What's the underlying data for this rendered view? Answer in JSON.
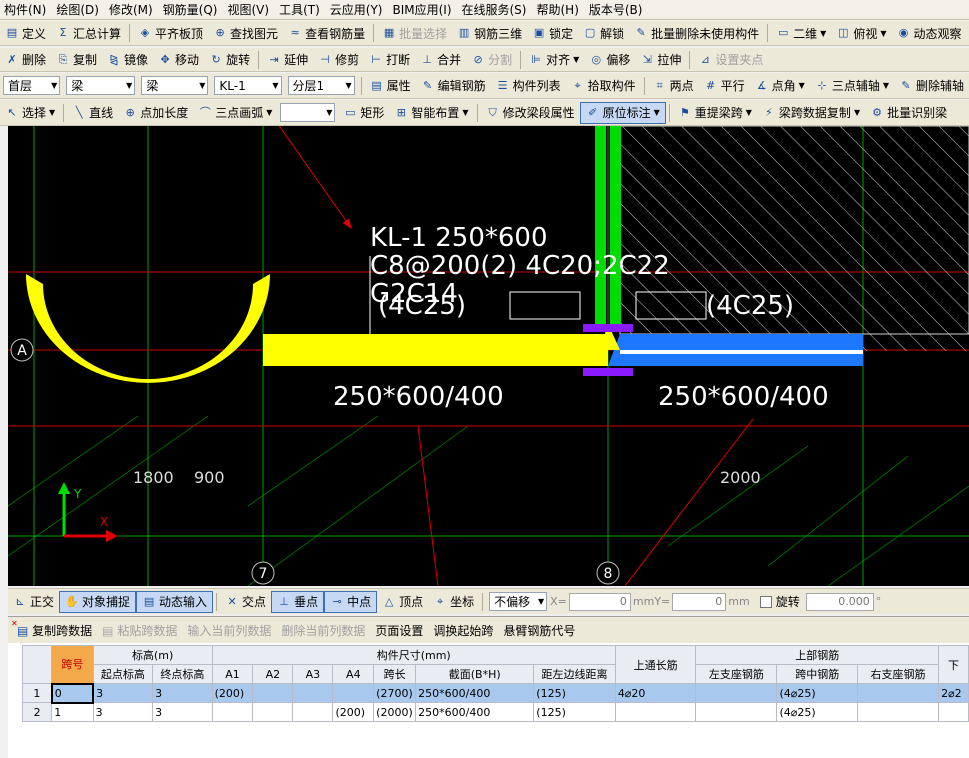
{
  "menu": [
    "构件(N)",
    "绘图(D)",
    "修改(M)",
    "钢筋量(Q)",
    "视图(V)",
    "工具(T)",
    "云应用(Y)",
    "BIM应用(I)",
    "在线服务(S)",
    "帮助(H)",
    "版本号(B)"
  ],
  "toolbar1": [
    {
      "icon": "definition-icon",
      "glyph": "▤",
      "label": "定义"
    },
    {
      "icon": "sigma-icon",
      "glyph": "Σ",
      "label": "汇总计算"
    },
    {
      "icon": "align-slab-icon",
      "glyph": "◈",
      "label": "平齐板顶"
    },
    {
      "icon": "binoculars-icon",
      "glyph": "⊕",
      "label": "查找图元"
    },
    {
      "icon": "rebar-qty-icon",
      "glyph": "≈",
      "label": "查看钢筋量"
    },
    {
      "icon": "batch-select-icon",
      "glyph": "▦",
      "label": "批量选择",
      "disabled": true
    },
    {
      "icon": "rebar-3d-icon",
      "glyph": "▥",
      "label": "钢筋三维"
    },
    {
      "icon": "lock-icon",
      "glyph": "▣",
      "label": "锁定"
    },
    {
      "icon": "unlock-icon",
      "glyph": "▢",
      "label": "解锁"
    },
    {
      "icon": "batch-delete-icon",
      "glyph": "✎",
      "label": "批量删除未使用构件"
    },
    {
      "icon": "view-2d-icon",
      "glyph": "▭",
      "label": "二维",
      "dropdown": true
    },
    {
      "icon": "top-view-icon",
      "glyph": "◫",
      "label": "俯视",
      "dropdown": true
    },
    {
      "icon": "orbit-icon",
      "glyph": "◉",
      "label": "动态观察"
    }
  ],
  "toolbar2": [
    {
      "icon": "delete-icon",
      "glyph": "✗",
      "label": "删除"
    },
    {
      "icon": "copy-icon",
      "glyph": "⎘",
      "label": "复制"
    },
    {
      "icon": "mirror-icon",
      "glyph": "⧎",
      "label": "镜像"
    },
    {
      "icon": "move-icon",
      "glyph": "✥",
      "label": "移动"
    },
    {
      "icon": "rotate-icon",
      "glyph": "↻",
      "label": "旋转"
    },
    {
      "icon": "extend-icon",
      "glyph": "⇥",
      "label": "延伸"
    },
    {
      "icon": "trim-icon",
      "glyph": "⊣",
      "label": "修剪"
    },
    {
      "icon": "break-icon",
      "glyph": "⊢",
      "label": "打断"
    },
    {
      "icon": "merge-icon",
      "glyph": "⊥",
      "label": "合并"
    },
    {
      "icon": "split-icon",
      "glyph": "⊘",
      "label": "分割",
      "disabled": true
    },
    {
      "icon": "align-icon",
      "glyph": "⊫",
      "label": "对齐",
      "dropdown": true
    },
    {
      "icon": "offset-icon",
      "glyph": "◎",
      "label": "偏移"
    },
    {
      "icon": "stretch-icon",
      "glyph": "⇲",
      "label": "拉伸"
    },
    {
      "icon": "set-pinch-icon",
      "glyph": "⊿",
      "label": "设置夹点",
      "disabled": true
    }
  ],
  "toolbar3": {
    "combos": [
      {
        "name": "floor-select",
        "value": "首层",
        "width": 58
      },
      {
        "name": "category-select",
        "value": "梁",
        "width": 70
      },
      {
        "name": "type-select",
        "value": "梁",
        "width": 68
      },
      {
        "name": "member-select",
        "value": "KL-1",
        "width": 68
      },
      {
        "name": "layer-select",
        "value": "分层1",
        "width": 68
      }
    ],
    "buttons": [
      {
        "icon": "property-icon",
        "glyph": "▤",
        "label": "属性"
      },
      {
        "icon": "edit-rebar-icon",
        "glyph": "✎",
        "label": "编辑钢筋"
      },
      {
        "icon": "member-list-icon",
        "glyph": "☰",
        "label": "构件列表"
      },
      {
        "icon": "pick-member-icon",
        "glyph": "⌖",
        "label": "拾取构件"
      },
      {
        "icon": "two-point-icon",
        "glyph": "⌗",
        "label": "两点"
      },
      {
        "icon": "parallel-icon",
        "glyph": "#",
        "label": "平行"
      },
      {
        "icon": "point-angle-icon",
        "glyph": "∡",
        "label": "点角",
        "dropdown": true
      },
      {
        "icon": "three-point-aux-icon",
        "glyph": "⊹",
        "label": "三点辅轴",
        "dropdown": true
      },
      {
        "icon": "delete-aux-icon",
        "glyph": "✎",
        "label": "删除辅轴"
      }
    ]
  },
  "toolbar4": [
    {
      "icon": "select-icon",
      "glyph": "↖",
      "label": "选择",
      "dropdown": true
    },
    {
      "icon": "line-icon",
      "glyph": "╲",
      "label": "直线"
    },
    {
      "icon": "point-length-icon",
      "glyph": "⊕",
      "label": "点加长度"
    },
    {
      "icon": "arc-icon",
      "glyph": "⌒",
      "label": "三点画弧",
      "dropdown": true
    },
    {
      "combo": true,
      "value": "",
      "width": 55
    },
    {
      "icon": "rectangle-icon",
      "glyph": "▭",
      "label": "矩形"
    },
    {
      "icon": "smart-layout-icon",
      "glyph": "⊞",
      "label": "智能布置",
      "dropdown": true
    },
    {
      "icon": "modify-span-icon",
      "glyph": "⛉",
      "label": "修改梁段属性"
    },
    {
      "icon": "origin-annotate-icon",
      "glyph": "✐",
      "label": "原位标注",
      "pressed": true,
      "dropdown": true
    },
    {
      "icon": "reextract-span-icon",
      "glyph": "⚑",
      "label": "重提梁跨",
      "dropdown": true
    },
    {
      "icon": "span-copy-icon",
      "glyph": "⚡",
      "label": "梁跨数据复制",
      "dropdown": true
    },
    {
      "icon": "batch-recognize-icon",
      "glyph": "⚙",
      "label": "批量识别梁"
    }
  ],
  "canvas": {
    "beam_label_lines": [
      "KL-1 250*600",
      "C8@200(2) 4C20;2C22",
      "G2C14"
    ],
    "left_support_label": "(4C25)",
    "right_support_label": "(4C25)",
    "span1_section": "250*600/400",
    "span2_section": "250*600/400",
    "dim_1800": "1800",
    "dim_900": "900",
    "dim_2000": "2000",
    "axis_a": "A",
    "axis_7": "7",
    "axis_8": "8",
    "ucs_y": "Y",
    "ucs_x": "X"
  },
  "statusbar": {
    "buttons": [
      {
        "icon": "ortho-icon",
        "glyph": "⊾",
        "label": "正交"
      },
      {
        "icon": "object-snap-icon",
        "glyph": "✋",
        "label": "对象捕捉",
        "pressed": true
      },
      {
        "icon": "dynamic-input-icon",
        "glyph": "▤",
        "label": "动态输入",
        "pressed": true
      },
      {
        "icon": "intersection-icon",
        "glyph": "✕",
        "label": "交点"
      },
      {
        "icon": "perpendicular-icon",
        "glyph": "⊥",
        "label": "垂点",
        "pressed": true
      },
      {
        "icon": "midpoint-icon",
        "glyph": "⊸",
        "label": "中点",
        "pressed": true
      },
      {
        "icon": "vertex-icon",
        "glyph": "△",
        "label": "顶点"
      },
      {
        "icon": "coordinate-icon",
        "glyph": "⌖",
        "label": "坐标"
      }
    ],
    "offset_combo": "不偏移",
    "x_label": "X=",
    "x_value": "0",
    "mm1": "mm",
    "y_label": "Y=",
    "y_value": "0",
    "mm2": "mm",
    "rotate_label": "旋转",
    "rotate_value": "0.000",
    "degree": "°"
  },
  "panel": {
    "tools": [
      {
        "icon": "copy-span-icon",
        "label": "复制跨数据"
      },
      {
        "icon": "paste-span-icon",
        "label": "粘贴跨数据",
        "disabled": true
      },
      {
        "label": "输入当前列数据",
        "disabled": true
      },
      {
        "label": "删除当前列数据",
        "disabled": true
      },
      {
        "label": "页面设置"
      },
      {
        "label": "调换起始跨"
      },
      {
        "label": "悬臂钢筋代号"
      }
    ],
    "headers": {
      "span_no": "跨号",
      "elevation": "标高(m)",
      "start_elev": "起点标高",
      "end_elev": "终点标高",
      "dims": "构件尺寸(mm)",
      "a1": "A1",
      "a2": "A2",
      "a3": "A3",
      "a4": "A4",
      "span_len": "跨长",
      "section": "截面(B*H)",
      "offset": "距左边线距离",
      "top_through": "上通长筋",
      "top_rebar": "上部钢筋",
      "left_support": "左支座钢筋",
      "mid_span": "跨中钢筋",
      "right_support": "右支座钢筋",
      "next": "下"
    },
    "rows": [
      {
        "row": "1",
        "span": "0",
        "start": "3",
        "end": "3",
        "a1": "(200)",
        "a2": "",
        "a3": "",
        "a4": "",
        "len": "(2700)",
        "section": "250*600/400",
        "offset": "(125)",
        "top": "4⌀20",
        "left": "",
        "mid": "(4⌀25)",
        "right": "",
        "next": "2⌀2"
      },
      {
        "row": "2",
        "span": "1",
        "start": "3",
        "end": "3",
        "a1": "",
        "a2": "",
        "a3": "",
        "a4": "(200)",
        "len": "(2000)",
        "section": "250*600/400",
        "offset": "(125)",
        "top": "",
        "left": "",
        "mid": "(4⌀25)",
        "right": "",
        "next": ""
      }
    ]
  },
  "colors": {
    "canvas_bg": "#000000",
    "beam_yellow": "#ffff00",
    "beam_blue": "#1e78ff",
    "column_green": "#00dd00",
    "marker_purple": "#8a1bff",
    "axis_red": "#c80000",
    "grid_green": "#00a000",
    "arrow_red": "#e00000",
    "selected_row": "#a9c8ee"
  }
}
